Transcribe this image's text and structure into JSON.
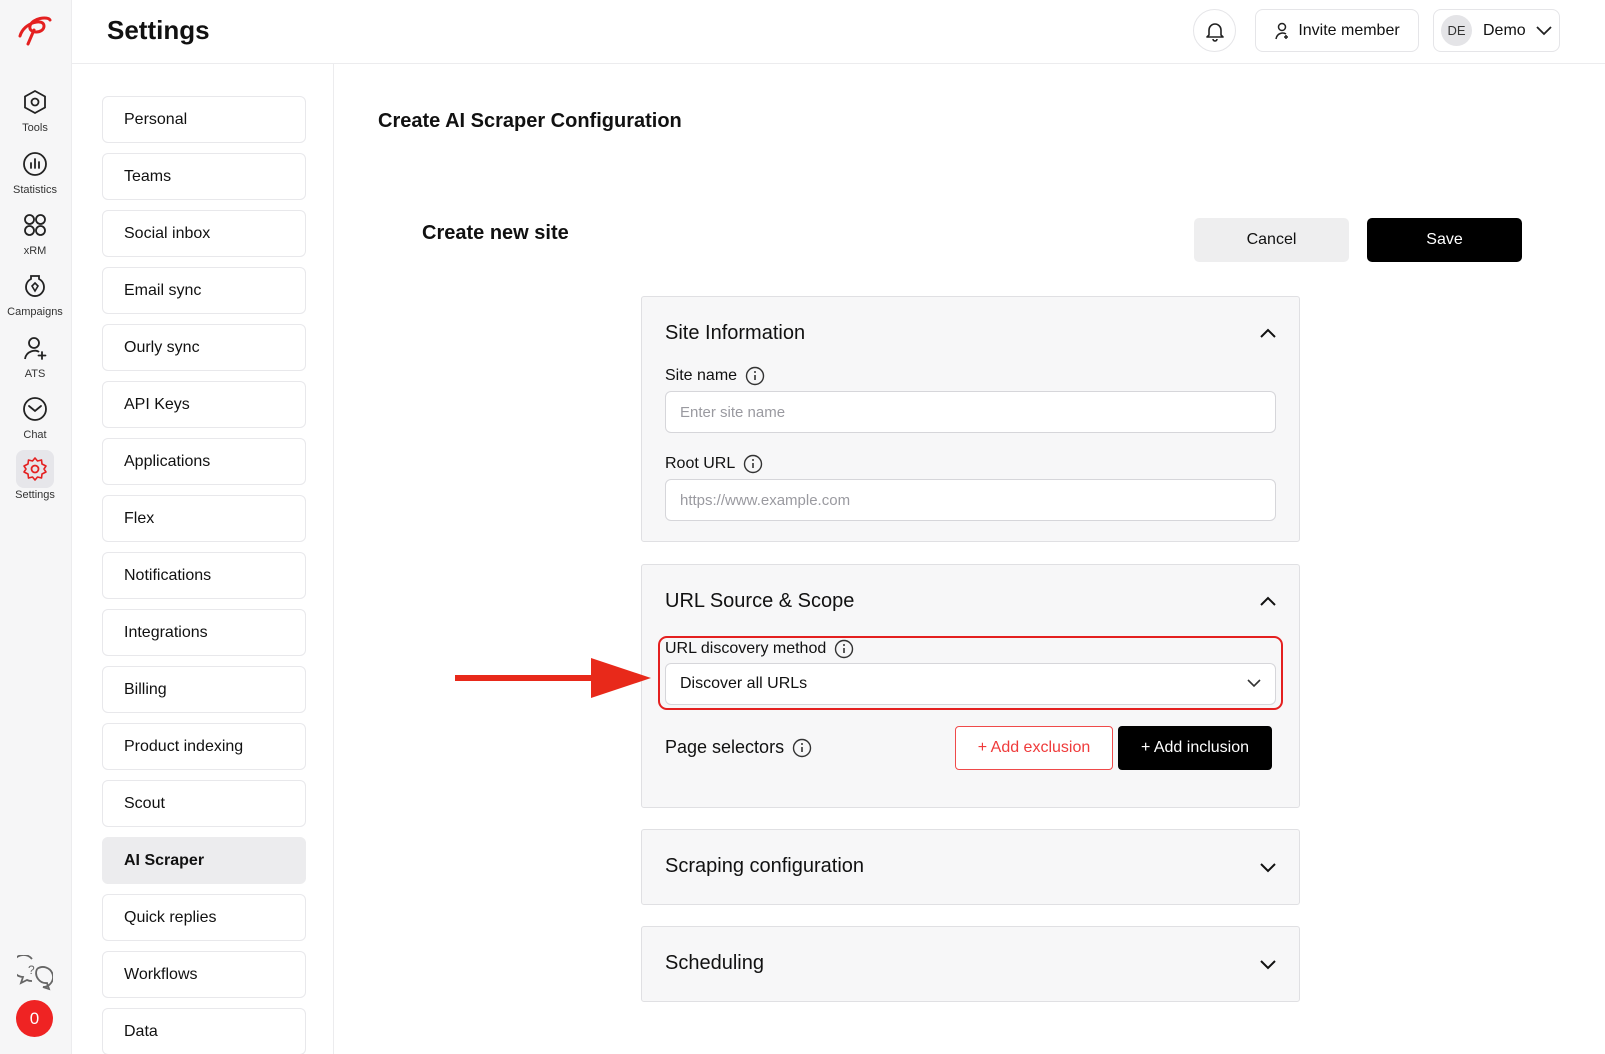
{
  "page": {
    "title": "Settings"
  },
  "header": {
    "invite_label": "Invite member",
    "user_initials": "DE",
    "user_name": "Demo",
    "bell_icon": "bell-icon",
    "invite_icon": "user-add-icon"
  },
  "rail": {
    "items": [
      {
        "label": "Tools",
        "icon": "hexagon-icon"
      },
      {
        "label": "Statistics",
        "icon": "bar-chart-icon"
      },
      {
        "label": "xRM",
        "icon": "grid-icon"
      },
      {
        "label": "Campaigns",
        "icon": "campaign-icon"
      },
      {
        "label": "ATS",
        "icon": "person-icon"
      },
      {
        "label": "Chat",
        "icon": "mail-icon"
      },
      {
        "label": "Settings",
        "icon": "gear-icon",
        "active": true
      }
    ],
    "badge_count": "0"
  },
  "settings_nav": {
    "items": [
      "Personal",
      "Teams",
      "Social inbox",
      "Email sync",
      "Ourly sync",
      "API Keys",
      "Applications",
      "Flex",
      "Notifications",
      "Integrations",
      "Billing",
      "Product indexing",
      "Scout",
      "AI Scraper",
      "Quick replies",
      "Workflows",
      "Data"
    ],
    "active": "AI Scraper"
  },
  "main": {
    "section_title": "Create AI Scraper Configuration",
    "subtitle": "Create new site",
    "cancel_label": "Cancel",
    "save_label": "Save",
    "site_info": {
      "title": "Site Information",
      "site_name_label": "Site name",
      "site_name_placeholder": "Enter site name",
      "site_name_value": "",
      "root_url_label": "Root URL",
      "root_url_placeholder": "https://www.example.com",
      "root_url_value": ""
    },
    "url_source": {
      "title": "URL Source & Scope",
      "discovery_label": "URL discovery method",
      "discovery_value": "Discover all URLs",
      "page_selectors_label": "Page selectors",
      "add_exclusion_label": "+ Add exclusion",
      "add_inclusion_label": "+ Add inclusion"
    },
    "scraping_config": {
      "title": "Scraping configuration"
    },
    "scheduling": {
      "title": "Scheduling"
    }
  },
  "colors": {
    "brand": "#e42020",
    "accent_black": "#000000",
    "annotation_arrow": "#e8291a"
  }
}
